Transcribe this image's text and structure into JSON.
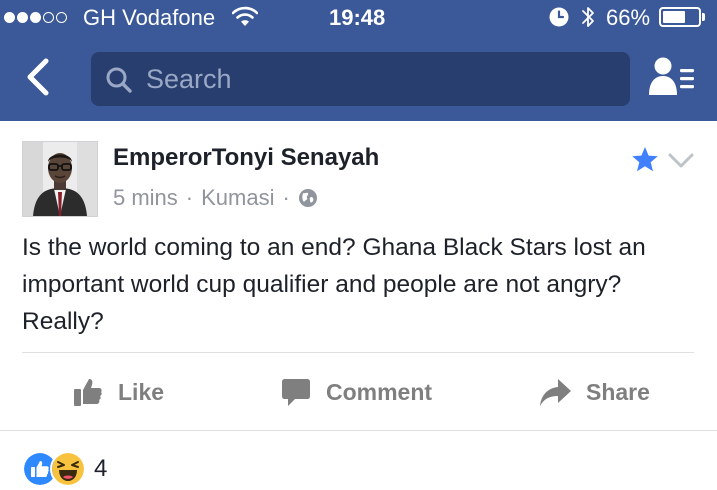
{
  "status_bar": {
    "carrier": "GH Vodafone",
    "time": "19:48",
    "battery_percent": "66%",
    "battery_level": 0.66,
    "signal_strength": 3,
    "signal_max": 5
  },
  "nav": {
    "search_placeholder": "Search"
  },
  "post": {
    "author": "EmperorTonyi Senayah",
    "time": "5 mins",
    "separator": "·",
    "location": "Kumasi",
    "text": "Is the world coming to an end? Ghana Black Stars lost an important world cup qualifier and people are not angry? Really?"
  },
  "actions": {
    "like": "Like",
    "comment": "Comment",
    "share": "Share"
  },
  "reactions": {
    "count": "4",
    "types": [
      "like-icon",
      "haha-icon"
    ]
  },
  "colors": {
    "brand": "#3b5998",
    "search_bg": "#273e6e",
    "favorite_star": "#4080ff",
    "action_gray": "#7f7f7f",
    "meta_gray": "#90949c",
    "like_blue": "#2e89ff",
    "haha_yellow": "#f7c33f"
  },
  "icons": {
    "back": "chevron-left-icon",
    "search": "search-icon",
    "friends": "friend-requests-icon",
    "star": "star-icon",
    "more": "chevron-down-icon",
    "privacy": "globe-icon"
  }
}
